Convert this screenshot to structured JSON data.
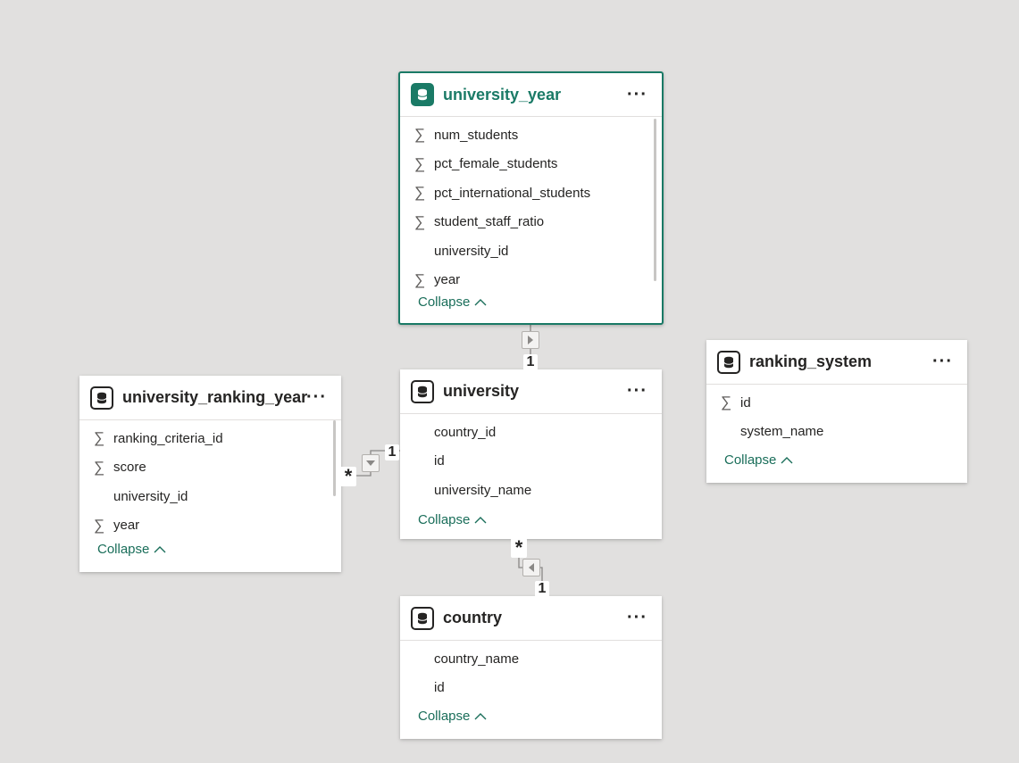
{
  "tables": {
    "university_year": {
      "title": "university_year",
      "fields": [
        {
          "name": "num_students",
          "sigma": "∑"
        },
        {
          "name": "pct_female_students",
          "sigma": "∑"
        },
        {
          "name": "pct_international_students",
          "sigma": "∑"
        },
        {
          "name": "student_staff_ratio",
          "sigma": "∑"
        },
        {
          "name": "university_id",
          "sigma": ""
        },
        {
          "name": "year",
          "sigma": "∑"
        }
      ],
      "collapse_label": "Collapse"
    },
    "university": {
      "title": "university",
      "fields": [
        {
          "name": "country_id",
          "sigma": ""
        },
        {
          "name": "id",
          "sigma": ""
        },
        {
          "name": "university_name",
          "sigma": ""
        }
      ],
      "collapse_label": "Collapse"
    },
    "university_ranking_year": {
      "title": "university_ranking_year",
      "fields": [
        {
          "name": "ranking_criteria_id",
          "sigma": "∑"
        },
        {
          "name": "score",
          "sigma": "∑"
        },
        {
          "name": "university_id",
          "sigma": ""
        },
        {
          "name": "year",
          "sigma": "∑"
        }
      ],
      "collapse_label": "Collapse"
    },
    "ranking_system": {
      "title": "ranking_system",
      "fields": [
        {
          "name": "id",
          "sigma": "∑"
        },
        {
          "name": "system_name",
          "sigma": ""
        }
      ],
      "collapse_label": "Collapse"
    },
    "country": {
      "title": "country",
      "fields": [
        {
          "name": "country_name",
          "sigma": ""
        },
        {
          "name": "id",
          "sigma": ""
        }
      ],
      "collapse_label": "Collapse"
    }
  },
  "more_label": "···",
  "relationships": {
    "uy_to_univ": {
      "one": "1"
    },
    "ury_to_univ": {
      "many": "*",
      "one": "1"
    },
    "country_to_univ": {
      "many": "*",
      "one": "1"
    }
  },
  "colors": {
    "background": "#e1e0df",
    "accent": "#1a7a66",
    "text": "#252423"
  },
  "icons": {
    "table": "database-icon",
    "measure": "sigma-icon",
    "more": "more-options-icon",
    "collapse": "chevron-up-icon",
    "filter_direction": "triangle-arrow-icon"
  }
}
